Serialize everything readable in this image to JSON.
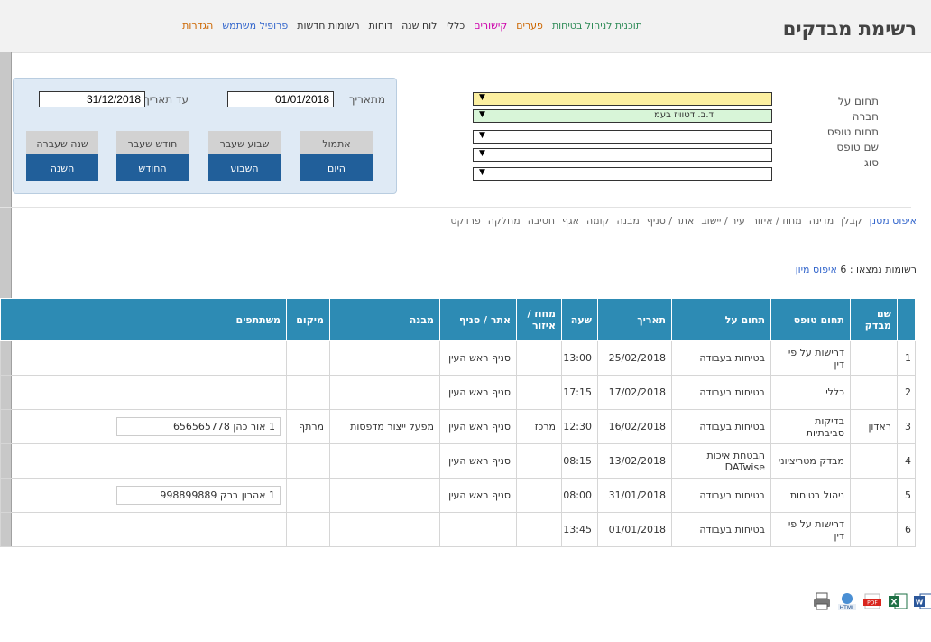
{
  "page_title": "רשימת מבדקים",
  "top_nav": [
    {
      "label": "תוכנית לניהול בטיחות",
      "color": "#2e8b57"
    },
    {
      "label": "פערים",
      "color": "#cc6600"
    },
    {
      "label": "קישורים",
      "color": "#cc00aa"
    },
    {
      "label": "כללי",
      "color": "#333333"
    },
    {
      "label": "לוח שנה",
      "color": "#333333"
    },
    {
      "label": "דוחות",
      "color": "#333333"
    },
    {
      "label": "רשומות חדשות",
      "color": "#333333"
    },
    {
      "label": "פרופיל משתמש",
      "color": "#3366cc"
    },
    {
      "label": "הגדרות",
      "color": "#cc6600"
    }
  ],
  "filters": {
    "labels": [
      "תחום על",
      "חברה",
      "תחום טופס",
      "שם טופס",
      "סוג"
    ],
    "company_value": "ד.ב. דטוויז בעמ",
    "caret": "▼"
  },
  "dates": {
    "from_label": "מתאריך",
    "from_value": "01/01/2018",
    "to_label": "עד תאריך",
    "to_value": "31/12/2018"
  },
  "period_buttons": {
    "past": [
      "אתמול",
      "שבוע שעבר",
      "חודש שעבר",
      "שנה שעברה"
    ],
    "now": [
      "היום",
      "השבוע",
      "החודש",
      "השנה"
    ]
  },
  "group_by": {
    "reset": "איפוס מסנן",
    "items": [
      "קבלן",
      "מדינה",
      "מחוז / איזור",
      "עיר / יישוב",
      "אתר / סניף",
      "מבנה",
      "קומה",
      "אגף",
      "חטיבה",
      "מחלקה",
      "פרויקט"
    ]
  },
  "records": {
    "label": "רשומות נמצאו : 6",
    "sort_reset": "איפוס מיון"
  },
  "columns": [
    "",
    "שם מבדק",
    "תחום טופס",
    "תחום על",
    "תאריך",
    "שעה",
    "מחוז / איזור",
    "אתר / סניף",
    "מבנה",
    "מיקום",
    "משתתפים"
  ],
  "rows": [
    {
      "n": "1",
      "auditor": "",
      "form": "דרישות על פי דין",
      "domain": "בטיחות בעבודה",
      "date": "25/02/2018",
      "time": "13:00",
      "district": "",
      "site": "סניף ראש העין",
      "building": "",
      "location": "",
      "participants": ""
    },
    {
      "n": "2",
      "auditor": "",
      "form": "כללי",
      "domain": "בטיחות בעבודה",
      "date": "17/02/2018",
      "time": "17:15",
      "district": "",
      "site": "סניף ראש העין",
      "building": "",
      "location": "",
      "participants": ""
    },
    {
      "n": "3",
      "auditor": "ראדון",
      "form": "בדיקות סביבתיות",
      "domain": "בטיחות בעבודה",
      "date": "16/02/2018",
      "time": "12:30",
      "district": "מרכז",
      "site": "סניף ראש העין",
      "building": "מפעל ייצור מדפסות",
      "location": "מרתף",
      "participants": "1 אור כהן 656565778"
    },
    {
      "n": "4",
      "auditor": "",
      "form": "מבדק מטריציוני",
      "domain": "הבטחת איכות DATwise",
      "date": "13/02/2018",
      "time": "08:15",
      "district": "",
      "site": "סניף ראש העין",
      "building": "",
      "location": "",
      "participants": ""
    },
    {
      "n": "5",
      "auditor": "",
      "form": "ניהול בטיחות",
      "domain": "בטיחות בעבודה",
      "date": "31/01/2018",
      "time": "08:00",
      "district": "",
      "site": "סניף ראש העין",
      "building": "",
      "location": "",
      "participants": "1 אהרון ברק 998899889"
    },
    {
      "n": "6",
      "auditor": "",
      "form": "דרישות על פי דין",
      "domain": "בטיחות בעבודה",
      "date": "01/01/2018",
      "time": "13:45",
      "district": "",
      "site": "",
      "building": "",
      "location": "",
      "participants": ""
    }
  ],
  "exports": {
    "html_label": "HTML",
    "pdf_label": "PDF",
    "excel_label": "X",
    "word_label": "W"
  }
}
